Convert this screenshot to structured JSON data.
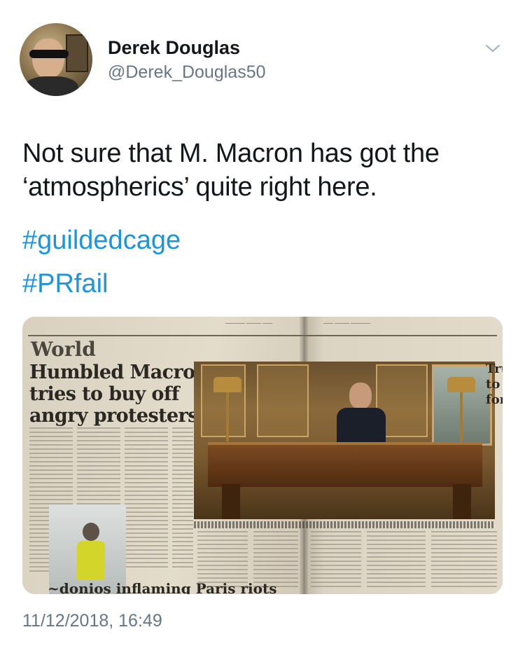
{
  "tweet": {
    "author_name": "Derek Douglas",
    "author_handle": "@Derek_Douglas50",
    "text_line1": "Not sure that M. Macron has got the",
    "text_line2": "‘atmospherics’ quite right here.",
    "hashtags": [
      "#guildedcage",
      "#PRfail"
    ],
    "timestamp": "11/12/2018, 16:49"
  },
  "media": {
    "newspaper": {
      "section": "World",
      "headline_lines": [
        "Humbled Macron",
        "tries to buy off",
        "angry protesters"
      ],
      "bottom_headline": "~donios inflaming Paris riots",
      "right_headline_lines": [
        "Tru",
        "to",
        "for"
      ]
    }
  },
  "icons": {
    "menu": "chevron-down-icon",
    "avatar": "avatar"
  },
  "colors": {
    "hashtag": "#1b95e0",
    "secondary_text": "#657786",
    "primary_text": "#14171a"
  }
}
